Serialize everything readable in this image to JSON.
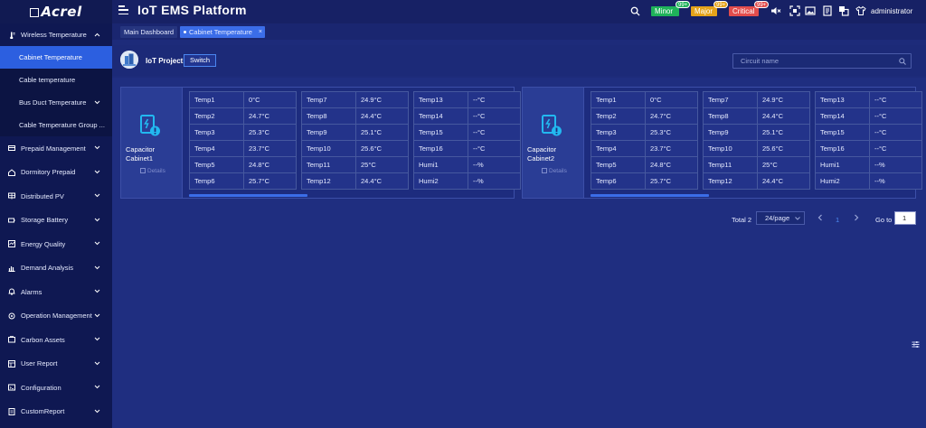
{
  "logo": {
    "text": "Acrel"
  },
  "app_title": "IoT EMS Platform",
  "header": {
    "alarms": [
      {
        "label": "Minor",
        "count": "99+",
        "color": "#1fb25a"
      },
      {
        "label": "Major",
        "count": "99+",
        "color": "#e5a31a"
      },
      {
        "label": "Critical",
        "count": "99+",
        "color": "#e24d4d"
      }
    ],
    "icons": [
      "search-icon",
      "mute-icon",
      "fullscreen-icon",
      "image-icon",
      "document-icon",
      "copy-icon",
      "shirt-icon"
    ],
    "username": "administrator"
  },
  "sidebar": {
    "items": [
      {
        "label": "Wireless Temperature",
        "icon": "thermometer-icon",
        "expanded": true
      },
      {
        "label": "Cabinet Temperature",
        "sub": true,
        "active": true
      },
      {
        "label": "Cable temperature",
        "sub": true
      },
      {
        "label": "Bus Duct Temperature",
        "sub": true
      },
      {
        "label": "Cable Temperature Group ...",
        "sub": true
      },
      {
        "label": "Prepaid Management",
        "icon": "prepaid-icon"
      },
      {
        "label": "Dormitory Prepaid",
        "icon": "dormitory-icon"
      },
      {
        "label": "Distributed PV",
        "icon": "solar-icon"
      },
      {
        "label": "Storage Battery",
        "icon": "battery-icon"
      },
      {
        "label": "Energy Quality",
        "icon": "quality-icon"
      },
      {
        "label": "Demand Analysis",
        "icon": "chart-icon"
      },
      {
        "label": "Alarms",
        "icon": "bell-icon"
      },
      {
        "label": "Operation Management",
        "icon": "operation-icon"
      },
      {
        "label": "Carbon Assets",
        "icon": "carbon-icon"
      },
      {
        "label": "User Report",
        "icon": "report-icon"
      },
      {
        "label": "Configuration",
        "icon": "config-icon"
      },
      {
        "label": "CustomReport",
        "icon": "custom-report-icon"
      }
    ]
  },
  "tabs": [
    {
      "label": "Main Dashboard",
      "active": false
    },
    {
      "label": "Cabinet Temperature",
      "active": true,
      "close": "×"
    }
  ],
  "project": {
    "label": "IoT Project",
    "switch_label": "Switch",
    "search_placeholder": "Circuit name"
  },
  "cards": [
    {
      "name": "Capacitor Cabinet1",
      "details": "Details",
      "columns": [
        [
          [
            "Temp1",
            "0°C"
          ],
          [
            "Temp2",
            "24.7°C"
          ],
          [
            "Temp3",
            "25.3°C"
          ],
          [
            "Temp4",
            "23.7°C"
          ],
          [
            "Temp5",
            "24.8°C"
          ],
          [
            "Temp6",
            "25.7°C"
          ]
        ],
        [
          [
            "Temp7",
            "24.9°C"
          ],
          [
            "Temp8",
            "24.4°C"
          ],
          [
            "Temp9",
            "25.1°C"
          ],
          [
            "Temp10",
            "25.6°C"
          ],
          [
            "Temp11",
            "25°C"
          ],
          [
            "Temp12",
            "24.4°C"
          ]
        ],
        [
          [
            "Temp13",
            "--°C"
          ],
          [
            "Temp14",
            "--°C"
          ],
          [
            "Temp15",
            "--°C"
          ],
          [
            "Temp16",
            "--°C"
          ],
          [
            "Humi1",
            "--%"
          ],
          [
            "Humi2",
            "--%"
          ]
        ]
      ]
    },
    {
      "name": "Capacitor Cabinet2",
      "details": "Details",
      "columns": [
        [
          [
            "Temp1",
            "0°C"
          ],
          [
            "Temp2",
            "24.7°C"
          ],
          [
            "Temp3",
            "25.3°C"
          ],
          [
            "Temp4",
            "23.7°C"
          ],
          [
            "Temp5",
            "24.8°C"
          ],
          [
            "Temp6",
            "25.7°C"
          ]
        ],
        [
          [
            "Temp7",
            "24.9°C"
          ],
          [
            "Temp8",
            "24.4°C"
          ],
          [
            "Temp9",
            "25.1°C"
          ],
          [
            "Temp10",
            "25.6°C"
          ],
          [
            "Temp11",
            "25°C"
          ],
          [
            "Temp12",
            "24.4°C"
          ]
        ],
        [
          [
            "Temp13",
            "--°C"
          ],
          [
            "Temp14",
            "--°C"
          ],
          [
            "Temp15",
            "--°C"
          ],
          [
            "Temp16",
            "--°C"
          ],
          [
            "Humi1",
            "--%"
          ],
          [
            "Humi2",
            "--%"
          ]
        ]
      ]
    }
  ],
  "pagination": {
    "total": "Total 2",
    "page_size": "24/page",
    "current_page": "1",
    "goto_label": "Go to",
    "goto_value": "1"
  }
}
